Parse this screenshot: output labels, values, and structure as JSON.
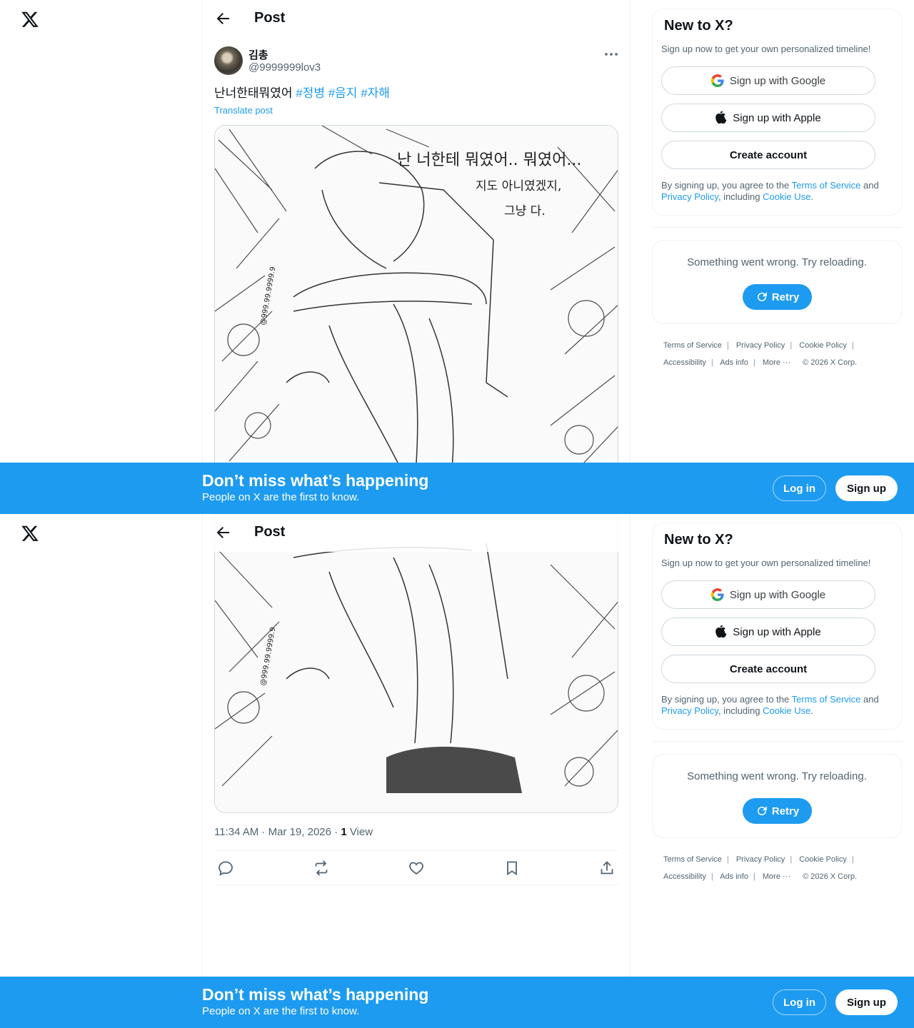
{
  "header": {
    "title": "Post"
  },
  "post": {
    "author_name": "김총",
    "author_handle": "@9999999lov3",
    "text": "난너한태뭐였어",
    "hashtags": [
      "#정병",
      "#음지",
      "#자해"
    ],
    "translate_label": "Translate post",
    "image_text": {
      "line1": "난 너한테 뭐였어.. 뭐였어...",
      "line2": "지도 아니였겠지,",
      "line3": "그냥 다.",
      "signature": "@999.99.9999.9"
    },
    "timestamp": "11:34 AM · Mar 19, 2026 · ",
    "views_count": "1",
    "views_label": " View"
  },
  "signup": {
    "title": "New to X?",
    "subtitle": "Sign up now to get your own personalized timeline!",
    "google_label": "Sign up with Google",
    "apple_label": "Sign up with Apple",
    "create_label": "Create account",
    "legal_prefix": "By signing up, you agree to the ",
    "terms_link": "Terms of Service",
    "legal_and": " and ",
    "privacy_link": "Privacy Policy",
    "legal_including": ", including ",
    "cookie_link": "Cookie Use",
    "legal_end": "."
  },
  "error": {
    "message": "Something went wrong. Try reloading.",
    "retry_label": "Retry"
  },
  "footer": {
    "links": [
      "Terms of Service",
      "Privacy Policy",
      "Cookie Policy",
      "Accessibility",
      "Ads info",
      "More ···"
    ],
    "copyright": "© 2026 X Corp."
  },
  "banner": {
    "title": "Don’t miss what’s happening",
    "subtitle": "People on X are the first to know.",
    "login_label": "Log in",
    "signup_label": "Sign up"
  },
  "colors": {
    "accent": "#1d9bf0",
    "text": "#0f1419",
    "muted": "#536471",
    "border": "#eff3f4"
  },
  "icons": [
    "x-logo-icon",
    "back-arrow-icon",
    "more-icon",
    "google-icon",
    "apple-icon",
    "refresh-icon",
    "reply-icon",
    "repost-icon",
    "like-icon",
    "bookmark-icon",
    "share-icon"
  ]
}
